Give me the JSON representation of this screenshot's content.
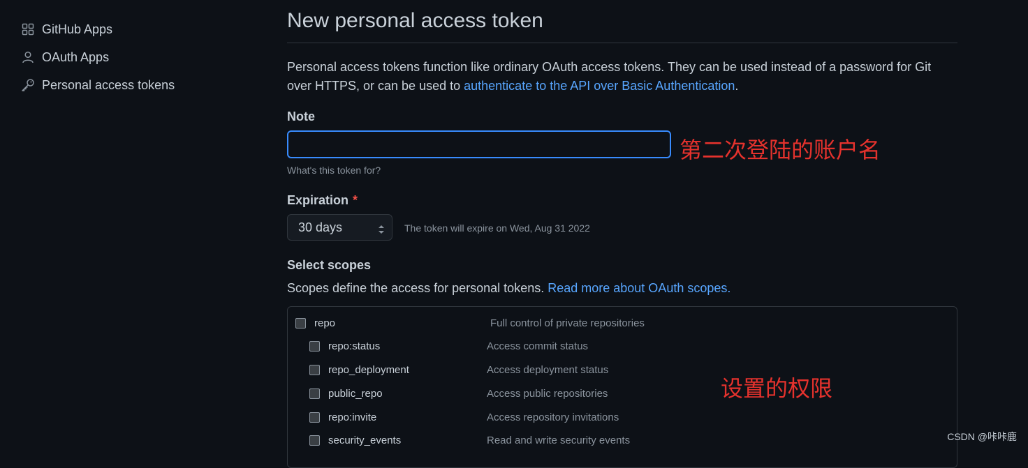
{
  "sidebar": {
    "items": [
      {
        "label": "GitHub Apps",
        "icon": "apps-grid-icon"
      },
      {
        "label": "OAuth Apps",
        "icon": "person-icon"
      },
      {
        "label": "Personal access tokens",
        "icon": "key-icon"
      }
    ]
  },
  "main": {
    "title": "New personal access token",
    "intro_text": "Personal access tokens function like ordinary OAuth access tokens. They can be used instead of a password for Git over HTTPS, or can be used to ",
    "intro_link": "authenticate to the API over Basic Authentication",
    "intro_end": ".",
    "note": {
      "label": "Note",
      "value": "",
      "help": "What's this token for?",
      "annotation": "第二次登陆的账户名"
    },
    "expiration": {
      "label": "Expiration",
      "required_marker": "*",
      "selected": "30 days",
      "note": "The token will expire on Wed, Aug 31 2022"
    },
    "scopes": {
      "label": "Select scopes",
      "desc_text": "Scopes define the access for personal tokens. ",
      "desc_link": "Read more about OAuth scopes.",
      "annotation": "设置的权限",
      "items": [
        {
          "name": "repo",
          "desc": "Full control of private repositories",
          "checked": false,
          "level": 0
        },
        {
          "name": "repo:status",
          "desc": "Access commit status",
          "checked": false,
          "level": 1
        },
        {
          "name": "repo_deployment",
          "desc": "Access deployment status",
          "checked": false,
          "level": 1
        },
        {
          "name": "public_repo",
          "desc": "Access public repositories",
          "checked": false,
          "level": 1
        },
        {
          "name": "repo:invite",
          "desc": "Access repository invitations",
          "checked": false,
          "level": 1
        },
        {
          "name": "security_events",
          "desc": "Read and write security events",
          "checked": false,
          "level": 1
        }
      ]
    }
  },
  "watermark": "CSDN @咔咔鹿",
  "colors": {
    "background": "#0d1117",
    "text": "#c9d1d9",
    "link": "#58a6ff",
    "focus_border": "#388bfd",
    "annotation": "#e5322d",
    "required": "#f85149"
  }
}
